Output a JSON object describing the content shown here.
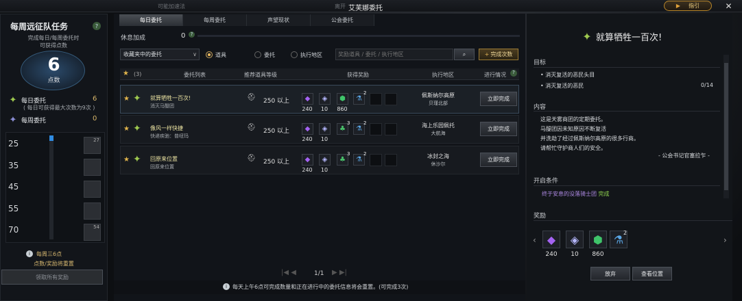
{
  "window": {
    "title": "艾芙娜委托",
    "guide_label": "指引",
    "close": "✕",
    "bg_left": "可能加速法",
    "bg_mid": "离开"
  },
  "left": {
    "title": "每周远征队任务",
    "subtitle": "完成每日/每周委托时\n可获得点数",
    "points": "6",
    "points_label": "点数",
    "daily_label": "每日委托",
    "daily_value": "6",
    "daily_note": "( 每日可获得最大次数为9次 )",
    "weekly_label": "每周委托",
    "weekly_value": "0",
    "levels": [
      "25",
      "35",
      "45",
      "55",
      "70"
    ],
    "level_counts": [
      "27",
      "",
      "",
      "",
      "54"
    ],
    "reset_note_1": "每周三6点",
    "reset_note_2": "点数/奖励将重置",
    "claim_button": "领取所有奖励"
  },
  "tabs": [
    "每日委托",
    "每周委托",
    "声望现状",
    "公会委托"
  ],
  "rest_bonus": {
    "label": "休息加成",
    "value": "0"
  },
  "filter": {
    "dropdown": "收藏夹中的委托",
    "radios": [
      "道具",
      "委托",
      "执行地区"
    ],
    "search_placeholder": "奖励道具 / 委托 / 执行地区",
    "complete_count_button": "完成次数"
  },
  "table": {
    "fav_count": "(3)",
    "headers": [
      "委托列表",
      "推荐道具等级",
      "获得奖励",
      "执行地区",
      "进行情况"
    ],
    "rows": [
      {
        "title": "就算牺牲一百次!",
        "subtitle": "消灭马醍团",
        "level": "250 以上",
        "rewards": [
          {
            "icon": "purple-crystal-icon",
            "n": "240"
          },
          {
            "icon": "silver-gem-icon",
            "n": "10"
          },
          {
            "icon": "green-crystal-icon",
            "n": "860"
          },
          {
            "icon": "blue-potion-icon",
            "n": "2"
          }
        ],
        "region_1": "佩斯纳尔高原",
        "region_2": "贝瑾北部",
        "action": "立即完成"
      },
      {
        "title": "像风一样快捷",
        "subtitle": "快递疾驰：普纽玛",
        "level": "250 以上",
        "rewards": [
          {
            "icon": "purple-crystal-icon",
            "n": "240"
          },
          {
            "icon": "silver-gem-icon",
            "n": "10"
          },
          {
            "icon": "green-herb-icon",
            "n": "3"
          },
          {
            "icon": "blue-potion-icon",
            "n": "2"
          }
        ],
        "region_1": "海上乐园佩托",
        "region_2": "大航海",
        "action": "立即完成"
      },
      {
        "title": "回原来位置",
        "subtitle": "回原来位置",
        "level": "250 以上",
        "rewards": [
          {
            "icon": "purple-crystal-icon",
            "n": "240"
          },
          {
            "icon": "silver-gem-icon",
            "n": "10"
          },
          {
            "icon": "green-herb-icon",
            "n": "3"
          },
          {
            "icon": "blue-potion-icon",
            "n": "2"
          }
        ],
        "region_1": "冰封之海",
        "region_2": "休沙尔",
        "action": "立即完成"
      }
    ],
    "pagination": "1/1"
  },
  "footer_note": "每天上午6点可完成数量和正在进行中的委托信息将会重置。(可完成3次)",
  "footer_note_highlight": "重置",
  "detail": {
    "title": "就算牺牲一百次!",
    "goal_label": "目标",
    "goals": [
      {
        "text": "消灭复活的恶民头目",
        "progress": ""
      },
      {
        "text": "消灭复活的恶民",
        "progress": "0/14"
      }
    ],
    "content_label": "内容",
    "content_lines": [
      "这是天雾商团的定期委托。",
      "马醍团因未知原因不断复活",
      "并洗劫了经过佩斯纳尔高原的很多行商。",
      "请帮忙守护商人们的安全。"
    ],
    "signature": "- 公会书记官塞拉乍 -",
    "condition_label": "开启条件",
    "condition_text": "终于安息的没落骑士团",
    "condition_status": "完成",
    "reward_label": "奖励",
    "rewards": [
      {
        "icon": "purple-crystal-icon",
        "n": "240"
      },
      {
        "icon": "silver-gem-icon",
        "n": "10"
      },
      {
        "icon": "green-crystal-icon",
        "n": "860"
      },
      {
        "icon": "blue-potion-icon",
        "n": "2"
      }
    ],
    "abandon": "放弃",
    "view_location": "查看位置"
  }
}
